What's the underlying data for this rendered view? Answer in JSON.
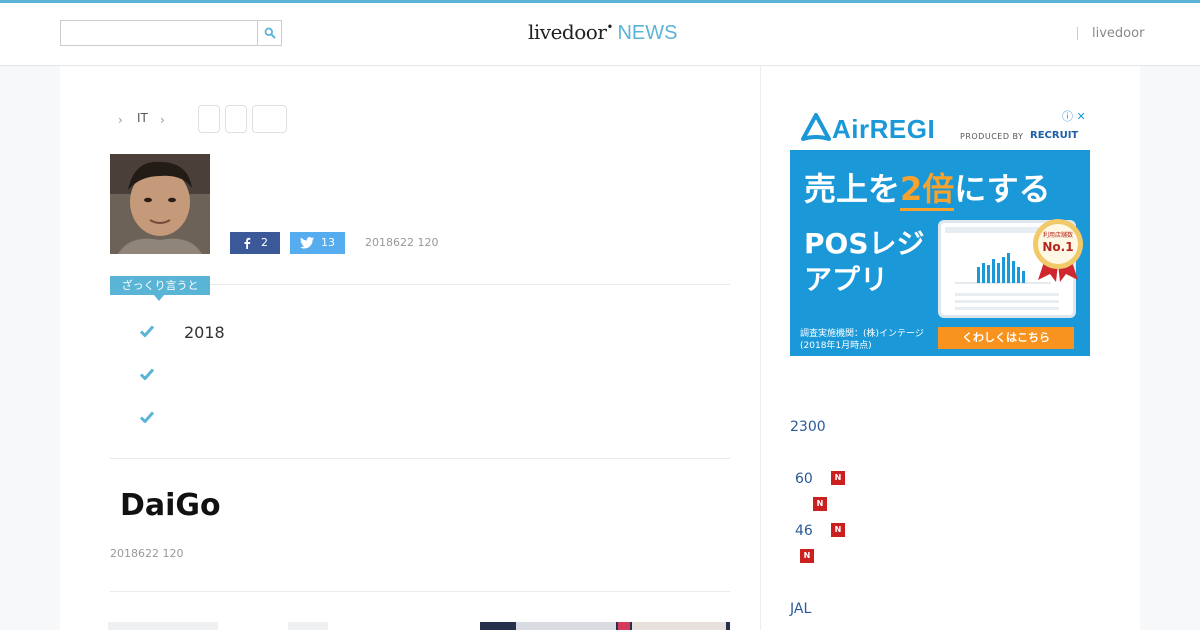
{
  "header": {
    "search_placeholder": "",
    "logo_main": "livedoor",
    "logo_news": "NEWS",
    "link": "livedoor"
  },
  "breadcrumb": {
    "category": "IT"
  },
  "share": {
    "facebook_count": "2",
    "twitter_count": "13"
  },
  "article": {
    "date_top": "2018622 120",
    "summary_label": "ざっくり言うと",
    "summary_items": [
      "2018",
      "",
      ""
    ],
    "headline": "DaiGo",
    "date_bottom": "2018622 120"
  },
  "ad": {
    "brand": "AirREGI",
    "produced_by": "PRODUCED BY",
    "recruit": "RECRUIT",
    "headline_pre": "売上を",
    "headline_accent": "2倍",
    "headline_post": "にする",
    "sub1": "POSレジ",
    "sub2": "アプリ",
    "medal_top": "利用店舗数",
    "medal_main": "No.1",
    "survey_line1": "調査実施機関：(株)インテージ",
    "survey_line2": "(2018年1月時点)",
    "cta": "くわしくはこちら"
  },
  "sidebar": {
    "items": [
      {
        "text": "2300",
        "new": false
      },
      {
        "text": "60",
        "new": true
      },
      {
        "text": "",
        "new": true
      },
      {
        "text": "46",
        "new": true
      },
      {
        "text": "",
        "new": true
      },
      {
        "text": "JAL",
        "new": false
      }
    ],
    "new_label": "N"
  },
  "colors": {
    "accent": "#5ab4d6",
    "facebook": "#3b5998",
    "twitter": "#55acee",
    "ad_blue": "#1a98d8",
    "ad_orange": "#f7931e",
    "new_badge": "#cc1f1f",
    "link": "#2a5a9a"
  },
  "icons": {
    "search": "search-icon",
    "chevron": "chevron-right-icon",
    "check": "check-icon",
    "facebook": "facebook-icon",
    "twitter": "twitter-icon"
  }
}
